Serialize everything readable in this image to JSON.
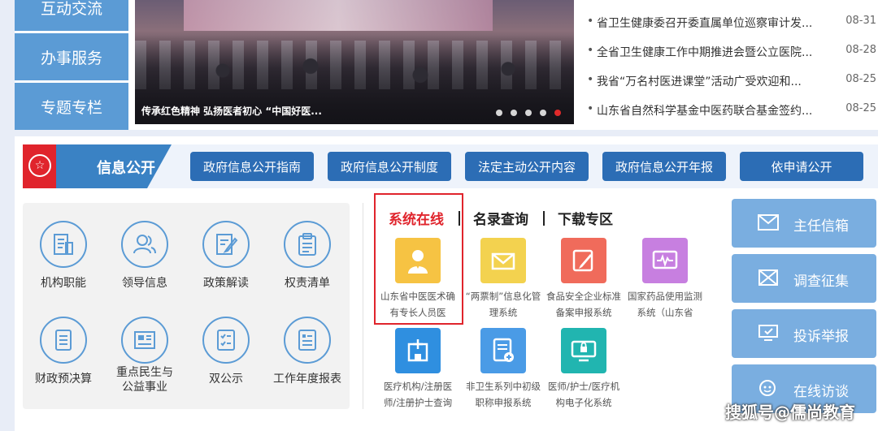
{
  "left_nav": [
    {
      "label": "互动交流"
    },
    {
      "label": "办事服务"
    },
    {
      "label": "专题专栏"
    }
  ],
  "banner": {
    "caption": "传承红色精神 弘扬医者初心 “中国好医...",
    "slides": 5,
    "active_slide": 5
  },
  "news": [
    {
      "title": "省卫生健康委召开委直属单位巡察审计发...",
      "date": "08-31"
    },
    {
      "title": "全省卫生健康工作中期推进会暨公立医院...",
      "date": "08-28"
    },
    {
      "title": "我省“万名村医进课堂”活动广受欢迎和...",
      "date": "08-25"
    },
    {
      "title": "山东省自然科学基金中医药联合基金签约...",
      "date": "08-25"
    }
  ],
  "info_section": {
    "title": "信息公开",
    "buttons": [
      "政府信息公开指南",
      "政府信息公开制度",
      "法定主动公开内容",
      "政府信息公开年报",
      "依申请公开"
    ]
  },
  "grid_items": [
    {
      "label": "机构职能",
      "icon": "building-doc-icon"
    },
    {
      "label": "领导信息",
      "icon": "people-icon"
    },
    {
      "label": "政策解读",
      "icon": "edit-doc-icon"
    },
    {
      "label": "权责清单",
      "icon": "clipboard-icon"
    },
    {
      "label": "财政预决算",
      "icon": "document-icon"
    },
    {
      "label": "重点民生与公益事业",
      "line1": "重点民生与",
      "line2": "公益事业",
      "icon": "news-panel-icon"
    },
    {
      "label": "双公示",
      "icon": "checklist-icon"
    },
    {
      "label": "工作年度报表",
      "icon": "report-icon"
    }
  ],
  "tabs": [
    {
      "label": "系统在线",
      "active": true
    },
    {
      "label": "名录查询",
      "active": false
    },
    {
      "label": "下载专区",
      "active": false
    }
  ],
  "apps": [
    {
      "label": "山东省中医医术确有专长人员医",
      "color": "#f6c343",
      "icon": "doctor-icon"
    },
    {
      "label": "“两票制”信息化管理系统",
      "color": "#f3d24f",
      "icon": "envelope-icon"
    },
    {
      "label": "食品安全企业标准备案申报系统",
      "color": "#f06b5b",
      "icon": "pencil-icon"
    },
    {
      "label": "国家药品使用监测系统（山东省",
      "color": "#c77fe0",
      "icon": "monitor-wave-icon"
    },
    {
      "label": "医疗机构/注册医师/注册护士查询",
      "color": "#2f8fe0",
      "icon": "hospital-icon"
    },
    {
      "label": "非卫生系列中初级职称申报系统",
      "color": "#4a9be6",
      "icon": "form-plus-icon"
    },
    {
      "label": "医师/护士/医疗机构电子化系统",
      "color": "#21b5b0",
      "icon": "computer-lock-icon"
    }
  ],
  "right_buttons": [
    {
      "label": "主任信箱",
      "icon": "mail-icon"
    },
    {
      "label": "调查征集",
      "icon": "survey-icon"
    },
    {
      "label": "投诉举报",
      "icon": "complaint-icon"
    },
    {
      "label": "在线访谈",
      "icon": "chat-icon"
    }
  ],
  "watermark": "搜狐号@儒尚教育"
}
